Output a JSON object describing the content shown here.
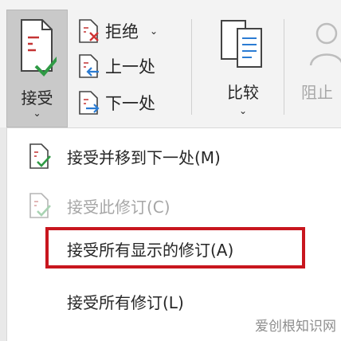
{
  "ribbon": {
    "accept": {
      "label": "接受",
      "dropdown_glyph": "⌄",
      "icon": "doc-check-icon"
    },
    "reject": {
      "label": "拒绝",
      "dropdown_glyph": "⌄",
      "icon": "doc-reject-icon"
    },
    "previous": {
      "label": "上一处",
      "icon": "doc-previous-icon"
    },
    "next": {
      "label": "下一处",
      "icon": "doc-next-icon"
    },
    "compare": {
      "label": "比较",
      "dropdown_glyph": "⌄",
      "icon": "compare-docs-icon"
    },
    "block": {
      "label": "阻止",
      "icon": "block-authors-icon",
      "state": "disabled"
    }
  },
  "accept_menu": {
    "items": [
      {
        "label": "接受并移到下一处(M)",
        "icon": "accept-move-next-icon",
        "enabled": true
      },
      {
        "label": "接受此修订(C)",
        "icon": "accept-this-icon",
        "enabled": false
      },
      {
        "label": "接受所有显示的修订(A)",
        "enabled": true,
        "highlighted": true
      },
      {
        "label": "接受所有修订(L)",
        "enabled": true
      }
    ]
  },
  "watermark": "爱创根知识网",
  "colors": {
    "highlight_border": "#c8161e",
    "accept_check": "#2f9a45",
    "reject_x": "#d03434",
    "nav_arrow": "#2b7cd3",
    "disabled_text": "#a6a6a6"
  }
}
